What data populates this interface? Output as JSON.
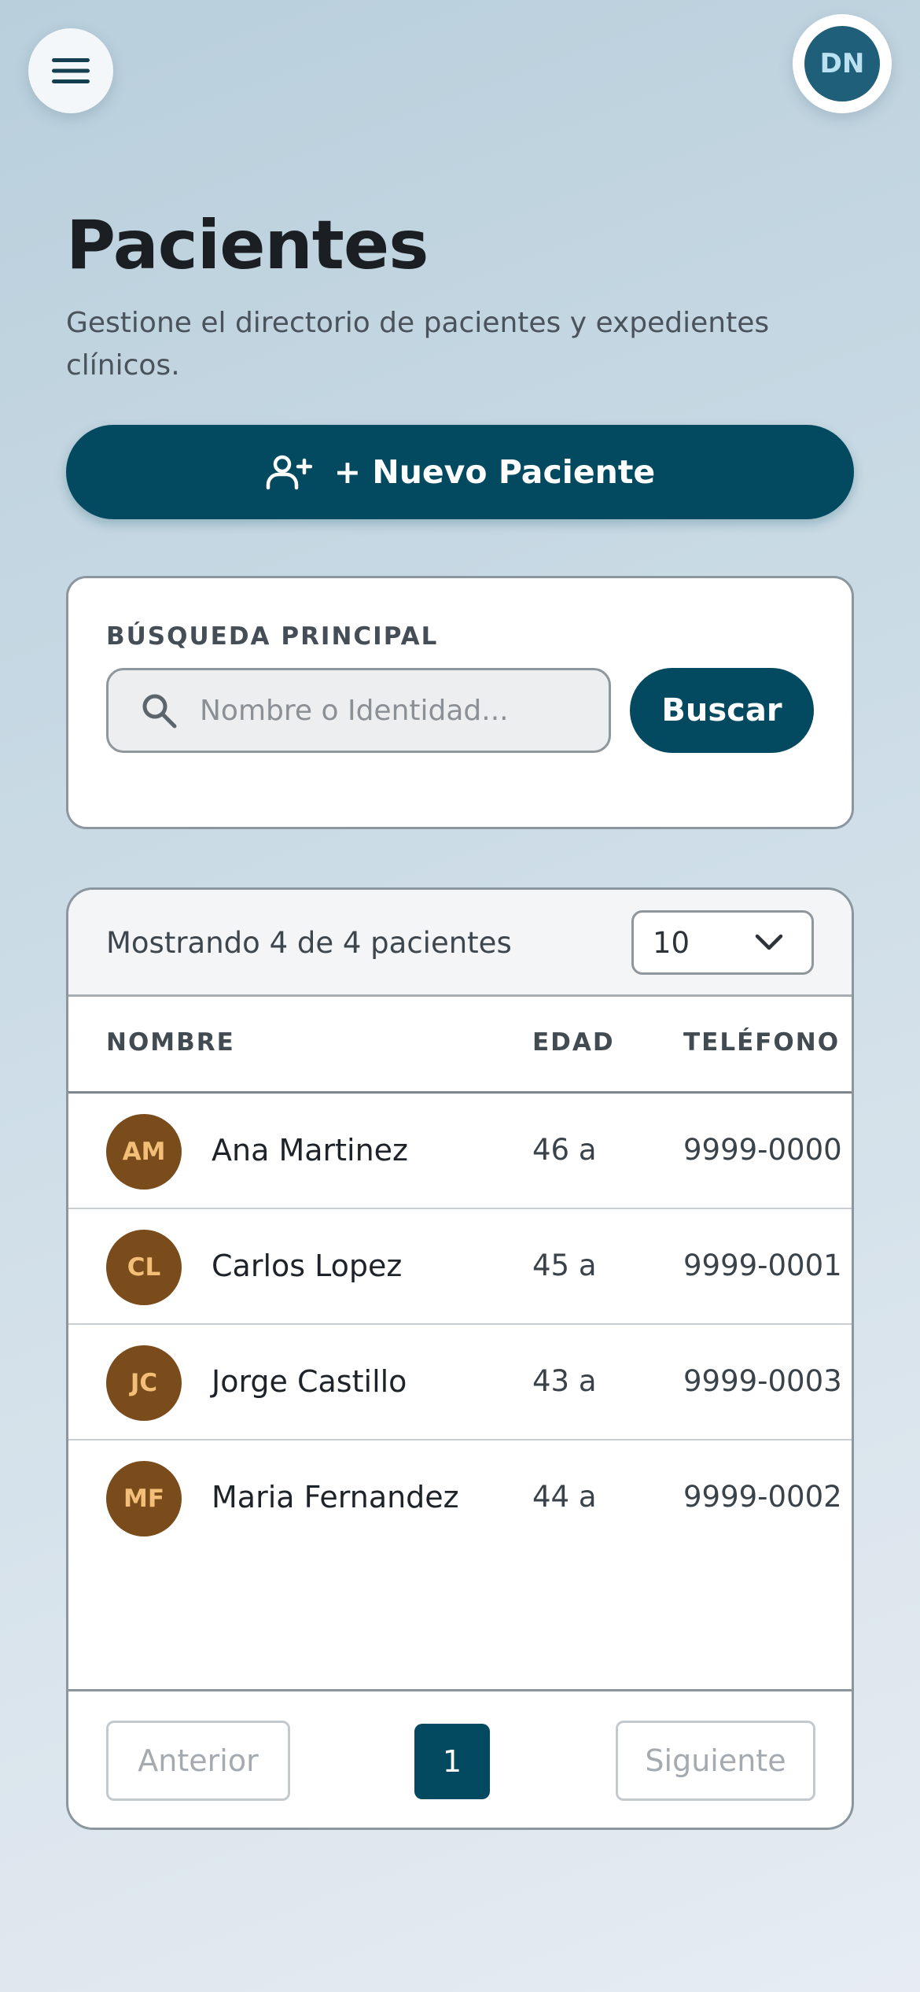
{
  "header": {
    "menu_icon": "menu-icon",
    "user_initials": "DN"
  },
  "page": {
    "title": "Pacientes",
    "subtitle": "Gestione el directorio de pacientes y expedientes clínicos."
  },
  "actions": {
    "new_patient_label": "+ Nuevo Paciente",
    "new_patient_icon": "user-plus-icon"
  },
  "search": {
    "section_label": "BÚSQUEDA PRINCIPAL",
    "placeholder": "Nombre o Identidad...",
    "value": "",
    "button_label": "Buscar",
    "icon": "search-icon"
  },
  "table": {
    "showing_text": "Mostrando 4 de 4 pacientes",
    "page_size": "10",
    "columns": {
      "name": "NOMBRE",
      "age": "EDAD",
      "phone": "TELÉFONO"
    },
    "rows": [
      {
        "initials": "AM",
        "name": "Ana Martinez",
        "age": "46 a",
        "phone": "9999-0000"
      },
      {
        "initials": "CL",
        "name": "Carlos Lopez",
        "age": "45 a",
        "phone": "9999-0001"
      },
      {
        "initials": "JC",
        "name": "Jorge Castillo",
        "age": "43 a",
        "phone": "9999-0003"
      },
      {
        "initials": "MF",
        "name": "Maria Fernandez",
        "age": "44 a",
        "phone": "9999-0002"
      }
    ]
  },
  "pagination": {
    "previous_label": "Anterior",
    "current_page": "1",
    "next_label": "Siguiente"
  },
  "colors": {
    "primary": "#034a60",
    "avatar_bg": "#7a4c1b",
    "avatar_text": "#f3be78",
    "user_avatar_bg": "#1f5f7a"
  }
}
